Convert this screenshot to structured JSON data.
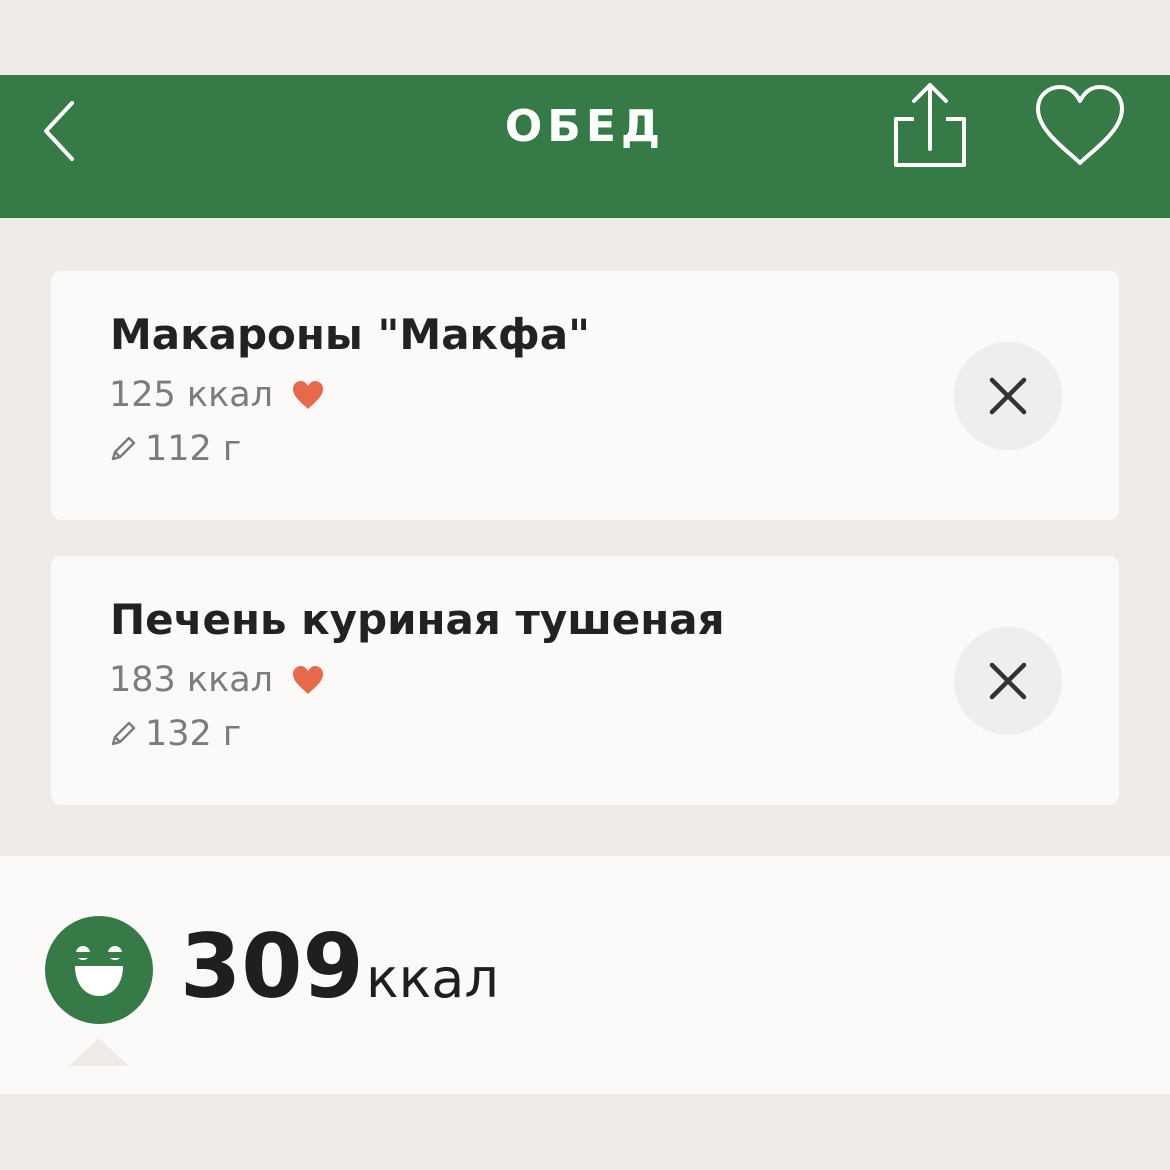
{
  "header": {
    "title": "ОБЕД",
    "back_icon": "chevron-left-icon",
    "share_icon": "share-icon",
    "favorite_icon": "heart-outline-icon",
    "background_color": "#357a47"
  },
  "items": [
    {
      "name": "Макароны \"Макфа\"",
      "kcal": "125 ккал",
      "weight": "112 г",
      "liked": true
    },
    {
      "name": "Печень куриная тушеная",
      "kcal": "183 ккал",
      "weight": "132 г",
      "liked": true
    }
  ],
  "summary": {
    "total_value": "309",
    "total_unit": "ккал",
    "mood_icon": "happy-face-icon"
  },
  "colors": {
    "accent_green": "#357a47",
    "heart": "#e8684a",
    "background": "#efece7",
    "card": "#fbfaf8"
  }
}
